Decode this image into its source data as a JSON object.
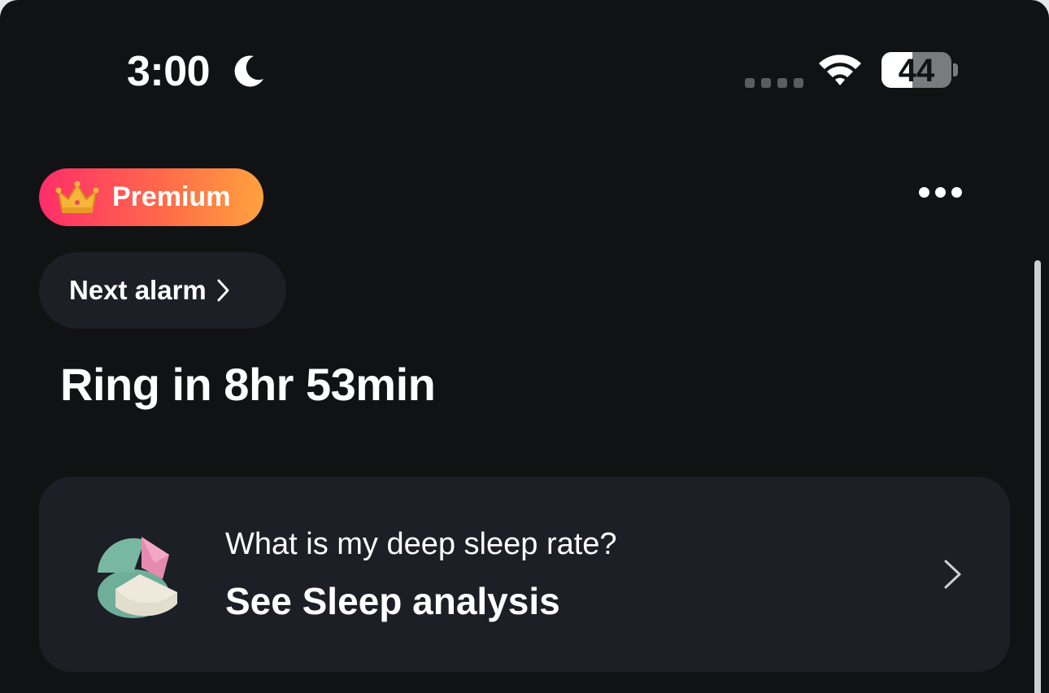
{
  "status_bar": {
    "time": "3:00",
    "battery_percent": "44",
    "battery_level": 0.44
  },
  "header": {
    "premium_label": "Premium",
    "premium_gradient": [
      "#ff2d6a",
      "#ffa23e"
    ]
  },
  "alarm": {
    "next_alarm_label": "Next alarm",
    "ring_text": "Ring in 8hr 53min"
  },
  "analysis_card": {
    "question": "What is my deep sleep rate?",
    "link_label": "See Sleep analysis",
    "icon": "sleep-pie-chart-icon"
  },
  "colors": {
    "background": "#111214",
    "card": "#1c1f26"
  }
}
